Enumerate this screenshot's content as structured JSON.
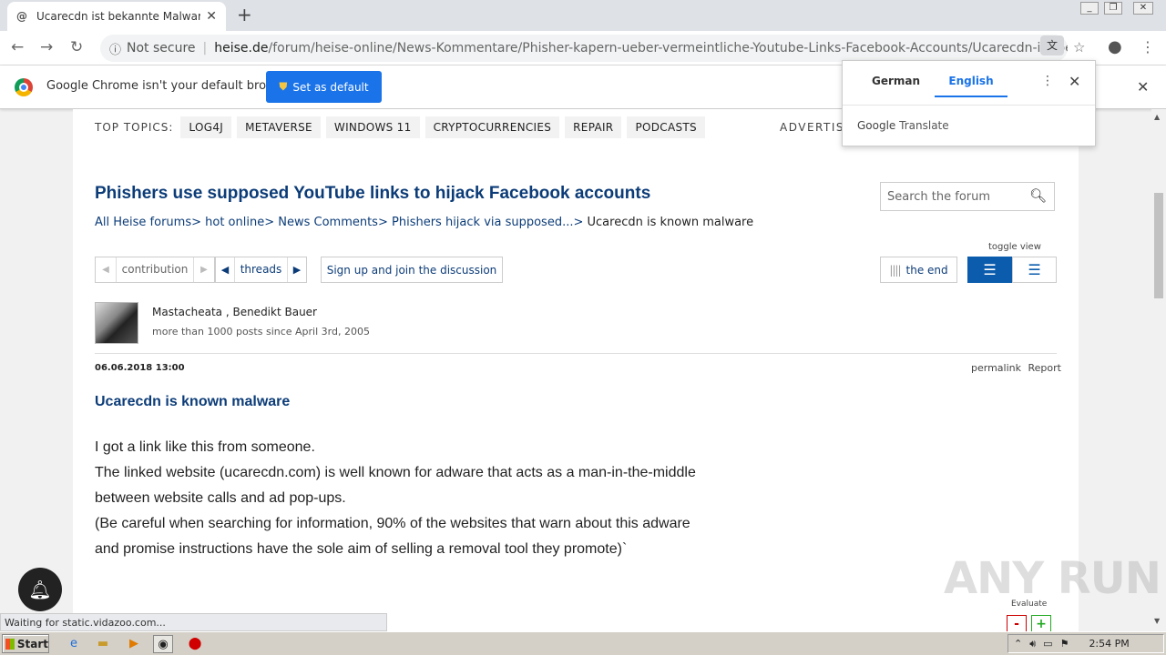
{
  "browser": {
    "tab_title": "Ucarecdn ist bekannte Malware | For",
    "tab_favicon": "@",
    "tab_close": "✕",
    "new_tab": "+",
    "not_secure": "Not secure",
    "url_domain": "heise.de",
    "url_path": "/forum/heise-online/News-Kommentare/Phisher-kapern-ueber-vermeintliche-Youtube-Links-Facebook-Accounts/Ucarecdn-ist-bekannte-Mal..."
  },
  "infobar": {
    "message": "Google Chrome isn't your default browser",
    "button": "Set as default",
    "close": "✕"
  },
  "translate": {
    "source_lang": "German",
    "target_lang": "English",
    "brand_google": "Google",
    "brand_translate": "Translate",
    "menu": "⋮",
    "close": "✕"
  },
  "page": {
    "top_topics_label": "TOP TOPICS:",
    "topics": [
      "LOG4J",
      "METAVERSE",
      "WINDOWS 11",
      "CRYPTOCURRENCIES",
      "REPAIR",
      "PODCASTS"
    ],
    "advert": "ADVERTIS",
    "title": "Phishers use supposed YouTube links to hijack Facebook accounts",
    "search_placeholder": "Search the forum",
    "breadcrumb": {
      "c1": "All Heise forums>",
      "c2": "hot online>",
      "c3": "News Comments>",
      "c4": "Phishers hijack via supposed...>",
      "c5": "Ucarecdn is known malware"
    },
    "toggle_view": "toggle view",
    "contribution": "contribution",
    "threads": "threads",
    "signup": "Sign up and join the discussion",
    "the_end": "the end",
    "author": "Mastacheata , Benedikt Bauer",
    "author_meta": "more than 1000 posts since April 3rd, 2005",
    "post_date": "06.06.2018 13:00",
    "permalink": "permalink",
    "report": "Report",
    "post_title": "Ucarecdn is known malware",
    "post_body": [
      "I got a link like this from someone.",
      "The linked website (ucarecdn.com) is well known for adware that acts as a man-in-the-middle",
      "between website calls and ad pop-ups.",
      "(Be careful when searching for information, 90% of the websites that warn about this adware",
      "and promise instructions have the sole aim of selling a removal tool they promote)`"
    ],
    "evaluate": "Evaluate",
    "minus": "-",
    "plus": "+"
  },
  "status_bar": "Waiting for static.vidazoo.com...",
  "watermark": "ANY RUN",
  "taskbar": {
    "start": "Start",
    "clock": "2:54 PM"
  },
  "colors": {
    "heise_blue": "#0c3c78",
    "chrome_blue": "#1a73e8"
  }
}
